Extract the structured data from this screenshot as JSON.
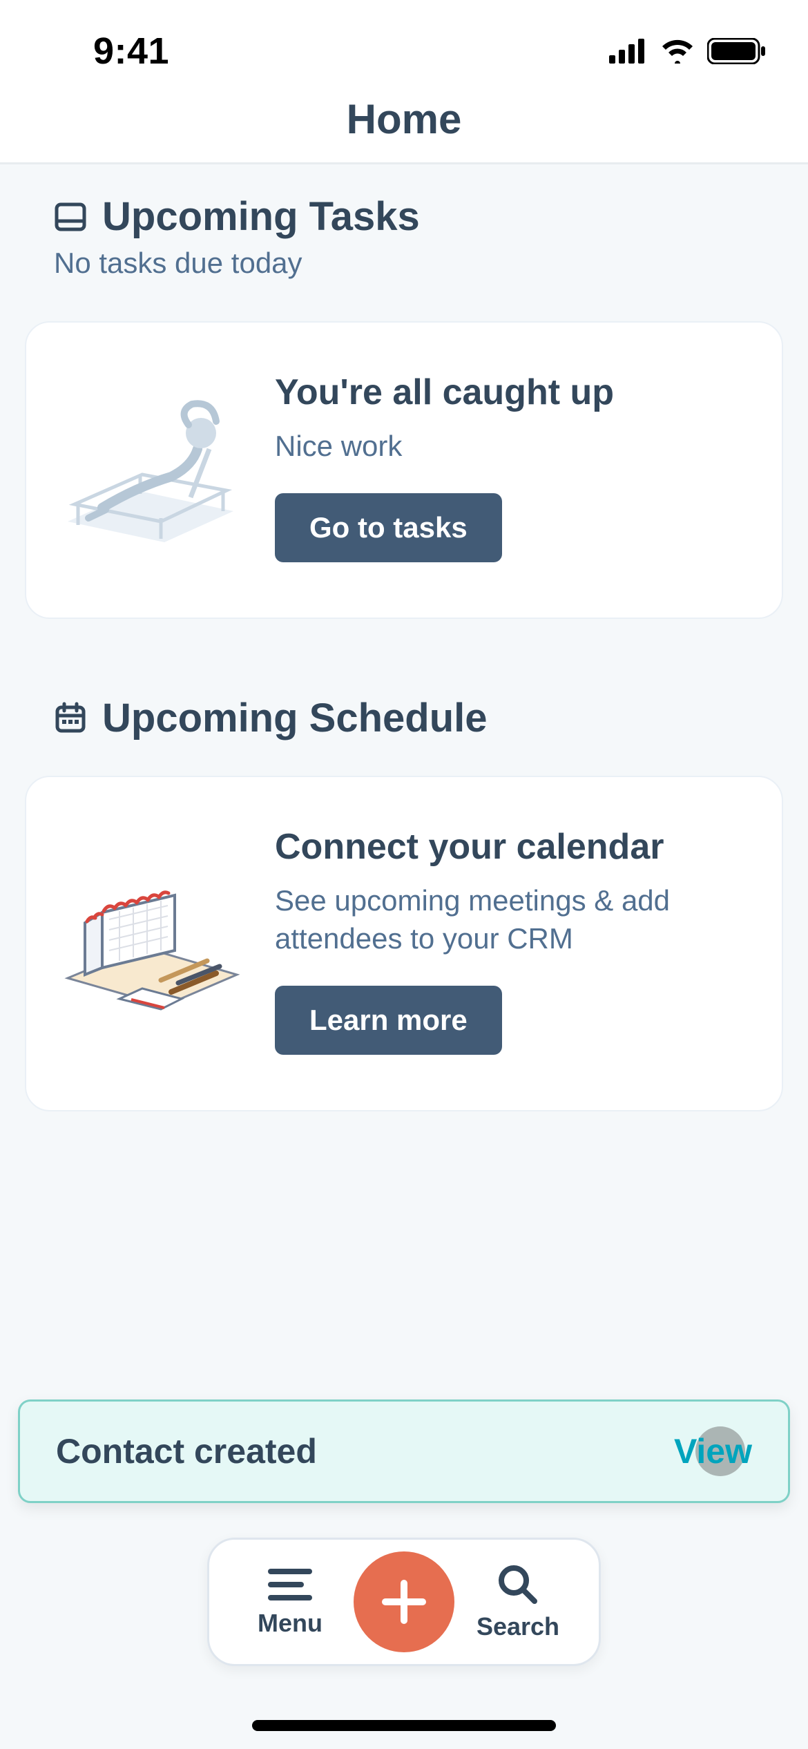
{
  "status": {
    "time": "9:41"
  },
  "header": {
    "title": "Home"
  },
  "tasks": {
    "heading": "Upcoming Tasks",
    "subtitle": "No tasks due today",
    "card": {
      "title": "You're all caught up",
      "body": "Nice work",
      "button": "Go to tasks"
    }
  },
  "schedule": {
    "heading": "Upcoming Schedule",
    "card": {
      "title": "Connect your calendar",
      "body": "See upcoming meetings & add attendees to your CRM",
      "button": "Learn more"
    }
  },
  "toast": {
    "message": "Contact created",
    "action": "View"
  },
  "bottomBar": {
    "menu": "Menu",
    "search": "Search"
  }
}
